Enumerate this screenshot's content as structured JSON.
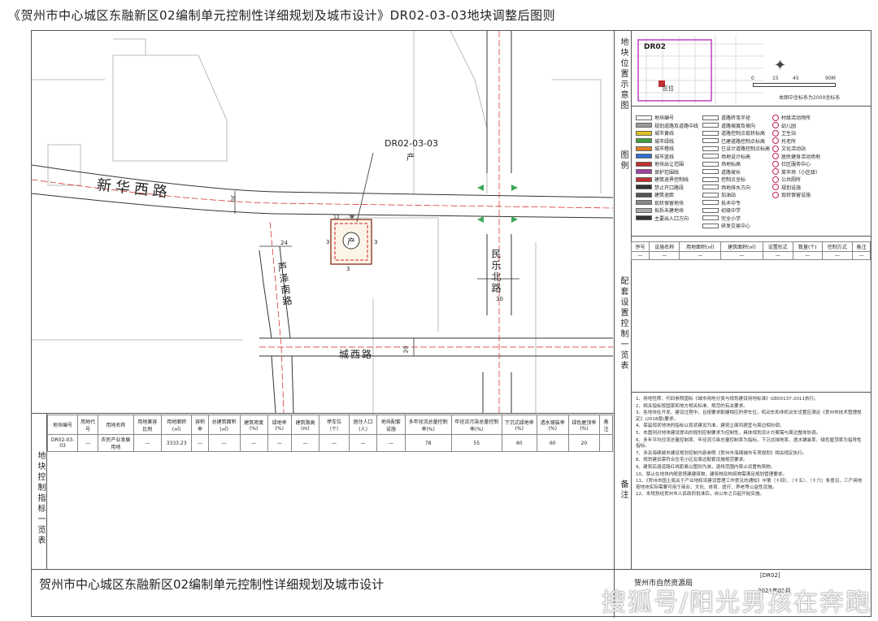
{
  "title": "《贺州市中心城区东融新区02编制单元控制性详细规划及城市设计》DR02-03-03地块调整后图则",
  "map": {
    "plot_id": "DR02-03-03",
    "plot_symbol": "产",
    "circle_label": "产",
    "roads": {
      "xinhua": "新华西路",
      "xinhua_width": "30",
      "chengxi": "城西路",
      "chengxi_width": "20",
      "minle": "民乐北路",
      "minle_width": "30",
      "luze": "芦泽南路",
      "luze_width": "24"
    },
    "setbacks": {
      "north": "12",
      "east": "3",
      "west": "3",
      "south": "3"
    }
  },
  "locator": {
    "label": "地块位置示意图",
    "unit_label": "DR02",
    "mark_label": "区位",
    "scale_ticks": [
      "0",
      "15",
      "45",
      "90M"
    ],
    "note": "本图中坐标系为2000坐标系"
  },
  "legend": {
    "label": "图例",
    "col1": [
      "地块编号",
      "规划道路及道路中线",
      "城市黄线",
      "城市绿线",
      "城市橙线",
      "城市蓝线",
      "地块出让范围",
      "保护范围线",
      "建筑退界控制线",
      "禁止开口路段",
      "建筑退距",
      "现状保留地块",
      "拟拆未建地块",
      "主要出入口方向"
    ],
    "col2": [
      "道路转弯半径",
      "道路坡度及坡向",
      "道路控制点现状标高",
      "已建道路控制点标高",
      "已设计道路控制点标高",
      "场地设计标高",
      "场地标高",
      "道路坡长",
      "控制点坐标",
      "场地排水方向",
      "加油站",
      "技术中专",
      "初级中学",
      "完全小学",
      "研发交易中心"
    ],
    "col3": [
      "村级活动场所",
      "幼儿园",
      "卫生站",
      "托老所",
      "文化活动站",
      "居民健身活动场地",
      "社区服务中心",
      "菜市场（小区级）",
      "公共厕所",
      "规划设施",
      "现状保留设施"
    ]
  },
  "facility_table": {
    "label": "配套设置控制一览表",
    "headers": [
      "序号",
      "设施名称",
      "用地面积(㎡)",
      "建筑面积(㎡)",
      "设置形式",
      "数量(个)",
      "控制方式",
      "备注"
    ],
    "row": [
      "—",
      "—",
      "—",
      "—",
      "—",
      "—",
      "—",
      "—"
    ]
  },
  "control_table": {
    "label": "地块控制指标一览表",
    "headers": [
      "地块编号",
      "用地代号",
      "用地名称",
      "用地兼容比例",
      "用地面积(㎡)",
      "容积率",
      "总建筑面积(㎡)",
      "建筑密度(%)",
      "绿地率(%)",
      "建筑限高(m)",
      "停车位（个）",
      "居住人口(人)",
      "地块配套设施",
      "多年径流总量控制率(%)",
      "年径流污染总量控制率(%)",
      "下沉式绿地率(%)",
      "透水铺装率(%)",
      "绿色屋顶率(%)",
      "备注"
    ],
    "row": [
      "DR02-03-03",
      "—",
      "农民产业发展用地",
      "—",
      "3333.23",
      "—",
      "—",
      "—",
      "—",
      "—",
      "—",
      "—",
      "—",
      "78",
      "55",
      "60",
      "60",
      "20",
      ""
    ]
  },
  "notes": {
    "label": "备注",
    "items": [
      "1、用地性质、代码参照国标《城市用地分类与规划建设用地标准》GB50137-2011执行。",
      "2、相关指标按国家和地方相关标准、规范的有关要求。",
      "3、各地块在开发、建设过程中，且按要求配建相应的停车位，机动车和非机动车设置应满足《贺州市技术管理规定》(2018版)要求。",
      "4、保留现状地块的指标以现状建设为准，建筑立面风貌宜与周边相协调。",
      "5、本图则对地块建设提出的规划控制要求为控制性，具体规划设计方案需与周边整体协调。",
      "6、多年平均径流总量控制率、年径流污染总量控制率为指标，下沉式绿地率、透水铺装率、绿色屋顶率为指导性指标。",
      "7、涉及海绵城市建设规划控制内容参照《贺州市海绵城市专项规划》相关规定执行。",
      "8、规划建设需符合住宅小区及周边配套设施规范要求。",
      "9、建筑后退道路红线距离以图则为准，退线范围内禁止设置构筑物。",
      "10、禁止在地块内随意搭建建筑物，建筑物及构筑物需满足规划管理要求。",
      "11、《贺州市国土局关于产业地和流建设管理工作意见的通知》中第（十四）、（十五）、（十六）条意见，三产用地按地块实际需要可用于商业、文化、体育、医疗、养老等公益性设施。",
      "12、本规划经贺州市人民政府批准后，自公布之日起开始实施。"
    ]
  },
  "footer": {
    "project_name": "贺州市中心城区东融新区02编制单元控制性详细规划及城市设计",
    "agency": "贺州市自然资源局",
    "code": "[DR02]",
    "date": "2021年01月"
  },
  "watermark": "搜狐号/阳光男孩在奔跑"
}
